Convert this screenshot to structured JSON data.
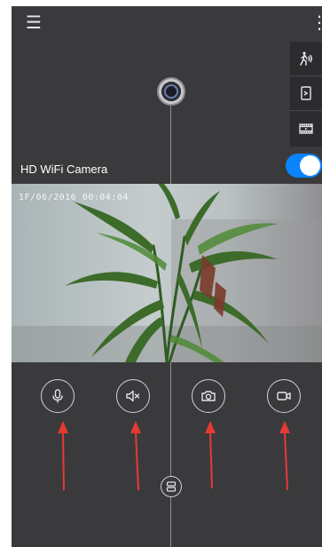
{
  "camera": {
    "name": "HD WiFi Camera",
    "enabled": true,
    "timestamp": "1F/06/2016 00:04:04"
  },
  "icons": {
    "menu": "menu-icon",
    "overflow": "more-vertical-icon",
    "motion": "motion-detection-icon",
    "sd_card": "sd-card-icon",
    "recordings": "film-icon",
    "microphone": "microphone-icon",
    "mute": "speaker-mute-icon",
    "snapshot": "camera-icon",
    "record": "video-record-icon",
    "split": "split-view-icon"
  },
  "colors": {
    "background": "#3a3a3c",
    "toggle_on": "#0a84ff",
    "annotation_arrow": "#e53935"
  }
}
